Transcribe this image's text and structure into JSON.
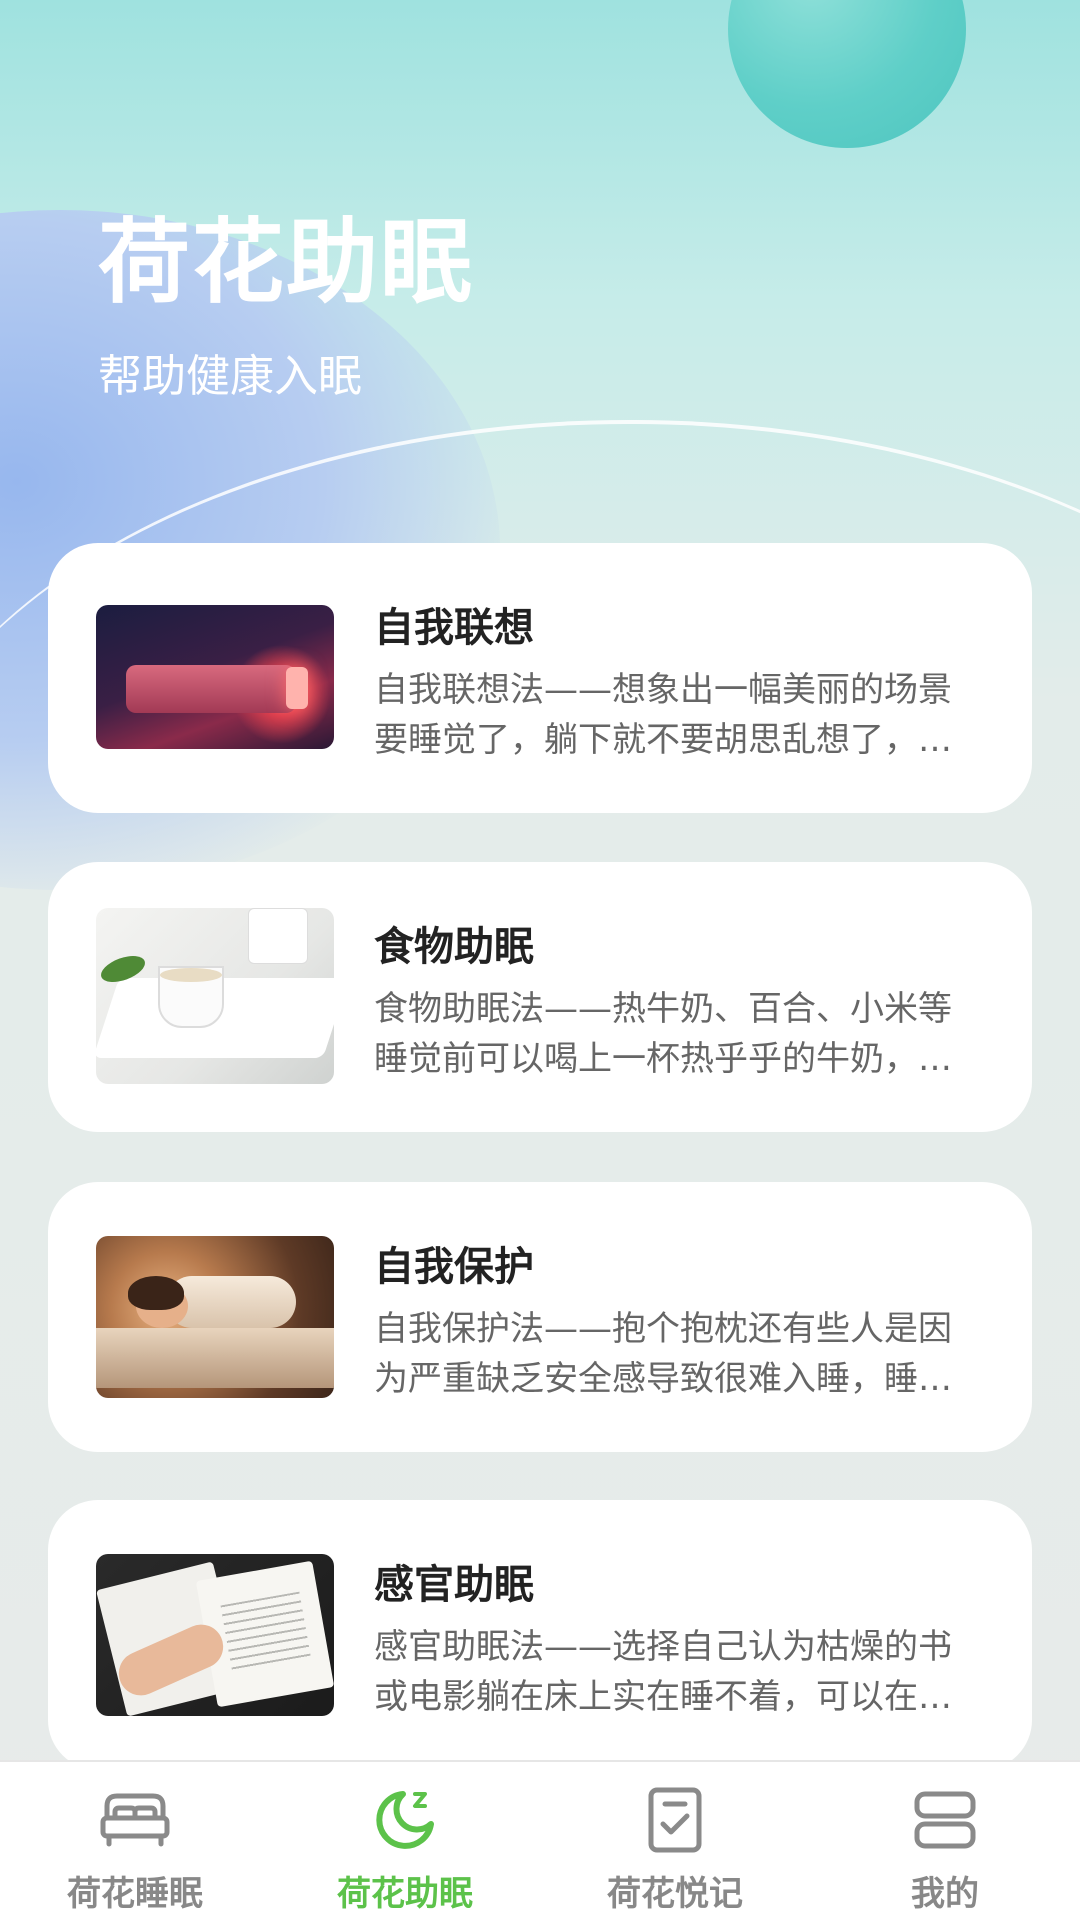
{
  "header": {
    "title": "荷花助眠",
    "subtitle": "帮助健康入眠"
  },
  "cards": [
    {
      "title": "自我联想",
      "desc_line1": "自我联想法——想象出一幅美丽的场景",
      "desc_line2": "要睡觉了，躺下就不要胡思乱想了，…",
      "image": "bed-with-red-lamp-image"
    },
    {
      "title": "食物助眠",
      "desc_line1": "食物助眠法——热牛奶、百合、小米等",
      "desc_line2": "睡觉前可以喝上一杯热乎乎的牛奶，…",
      "image": "milk-cup-image"
    },
    {
      "title": "自我保护",
      "desc_line1": "自我保护法——抱个抱枕还有些人是因",
      "desc_line2": "为严重缺乏安全感导致很难入睡，睡…",
      "image": "sleeping-woman-image"
    },
    {
      "title": "感官助眠",
      "desc_line1": "感官助眠法——选择自己认为枯燥的书",
      "desc_line2": "或电影躺在床上实在睡不着，可以在…",
      "image": "open-book-image"
    }
  ],
  "bottom_nav": [
    {
      "label": "荷花睡眠",
      "icon": "bed-icon",
      "active": false
    },
    {
      "label": "荷花助眠",
      "icon": "moon-icon",
      "active": true
    },
    {
      "label": "荷花悦记",
      "icon": "checklist-icon",
      "active": false
    },
    {
      "label": "我的",
      "icon": "profile-icon",
      "active": false
    }
  ],
  "colors": {
    "accent": "#5cc24a",
    "inactive": "#888888",
    "title_text": "#222222",
    "desc_text": "#666666"
  }
}
